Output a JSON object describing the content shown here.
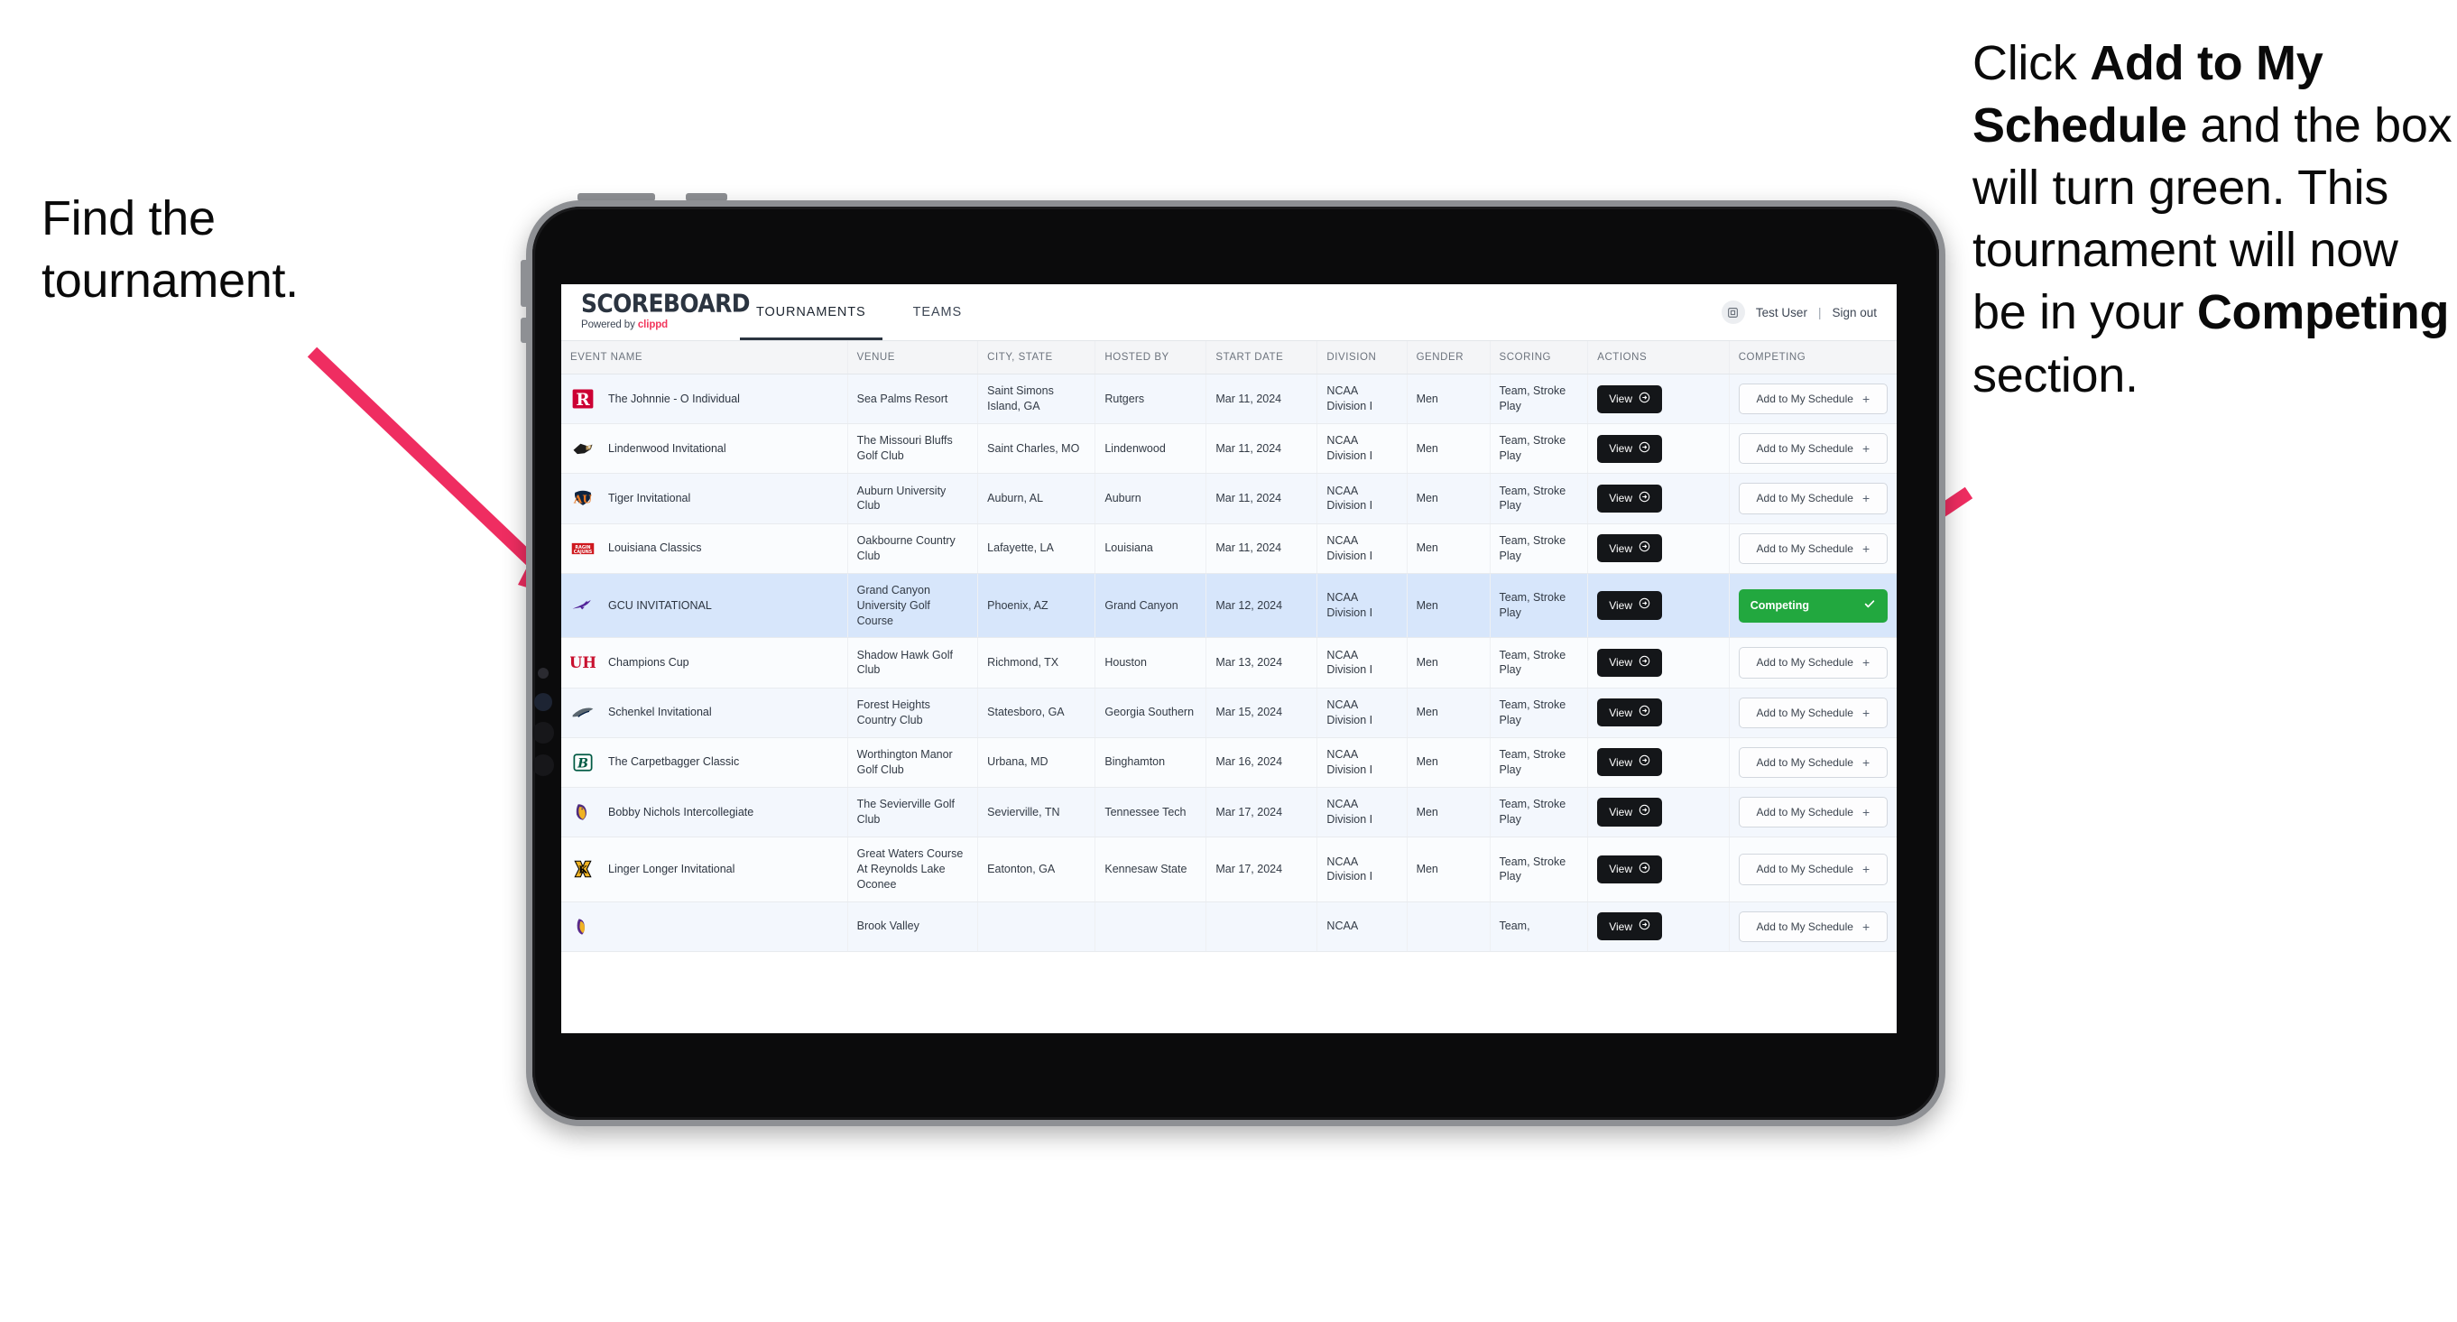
{
  "annotations": {
    "left": "Find the tournament.",
    "right_parts": [
      {
        "text": "Click ",
        "bold": false
      },
      {
        "text": "Add to My Schedule",
        "bold": true
      },
      {
        "text": " and the box will turn green. This tournament will now be in your ",
        "bold": false
      },
      {
        "text": "Competing",
        "bold": true
      },
      {
        "text": " section.",
        "bold": false
      }
    ],
    "arrow_color": "#ef2d61"
  },
  "app": {
    "brand_name": "SCOREBOARD",
    "brand_powered_prefix": "Powered by ",
    "brand_powered_name": "clippd",
    "tabs": [
      {
        "label": "TOURNAMENTS",
        "active": true
      },
      {
        "label": "TEAMS",
        "active": false
      }
    ],
    "user": {
      "avatar_icon": "user-badge-icon",
      "name": "Test User",
      "separator": "|",
      "sign_out": "Sign out"
    }
  },
  "table": {
    "columns": [
      "EVENT NAME",
      "VENUE",
      "CITY, STATE",
      "HOSTED BY",
      "START DATE",
      "DIVISION",
      "GENDER",
      "SCORING",
      "ACTIONS",
      "COMPETING"
    ],
    "view_label": "View",
    "add_label": "Add to My Schedule",
    "add_plus": "+",
    "competing_label": "Competing",
    "rows": [
      {
        "logo": "rutgers",
        "event": "The Johnnie - O Individual",
        "venue": "Sea Palms Resort",
        "city": "Saint Simons Island, GA",
        "host": "Rutgers",
        "date": "Mar 11, 2024",
        "division": "NCAA Division I",
        "gender": "Men",
        "scoring": "Team, Stroke Play",
        "competing": false
      },
      {
        "logo": "lindenwood",
        "event": "Lindenwood Invitational",
        "venue": "The Missouri Bluffs Golf Club",
        "city": "Saint Charles, MO",
        "host": "Lindenwood",
        "date": "Mar 11, 2024",
        "division": "NCAA Division I",
        "gender": "Men",
        "scoring": "Team, Stroke Play",
        "competing": false
      },
      {
        "logo": "auburn",
        "event": "Tiger Invitational",
        "venue": "Auburn University Club",
        "city": "Auburn, AL",
        "host": "Auburn",
        "date": "Mar 11, 2024",
        "division": "NCAA Division I",
        "gender": "Men",
        "scoring": "Team, Stroke Play",
        "competing": false
      },
      {
        "logo": "louisiana",
        "event": "Louisiana Classics",
        "venue": "Oakbourne Country Club",
        "city": "Lafayette, LA",
        "host": "Louisiana",
        "date": "Mar 11, 2024",
        "division": "NCAA Division I",
        "gender": "Men",
        "scoring": "Team, Stroke Play",
        "competing": false
      },
      {
        "logo": "gcu",
        "event": "GCU INVITATIONAL",
        "venue": "Grand Canyon University Golf Course",
        "city": "Phoenix, AZ",
        "host": "Grand Canyon",
        "date": "Mar 12, 2024",
        "division": "NCAA Division I",
        "gender": "Men",
        "scoring": "Team, Stroke Play",
        "competing": true
      },
      {
        "logo": "houston",
        "event": "Champions Cup",
        "venue": "Shadow Hawk Golf Club",
        "city": "Richmond, TX",
        "host": "Houston",
        "date": "Mar 13, 2024",
        "division": "NCAA Division I",
        "gender": "Men",
        "scoring": "Team, Stroke Play",
        "competing": false
      },
      {
        "logo": "georgiasouthern",
        "event": "Schenkel Invitational",
        "venue": "Forest Heights Country Club",
        "city": "Statesboro, GA",
        "host": "Georgia Southern",
        "date": "Mar 15, 2024",
        "division": "NCAA Division I",
        "gender": "Men",
        "scoring": "Team, Stroke Play",
        "competing": false
      },
      {
        "logo": "binghamton",
        "event": "The Carpetbagger Classic",
        "venue": "Worthington Manor Golf Club",
        "city": "Urbana, MD",
        "host": "Binghamton",
        "date": "Mar 16, 2024",
        "division": "NCAA Division I",
        "gender": "Men",
        "scoring": "Team, Stroke Play",
        "competing": false
      },
      {
        "logo": "tennesseetech",
        "event": "Bobby Nichols Intercollegiate",
        "venue": "The Sevierville Golf Club",
        "city": "Sevierville, TN",
        "host": "Tennessee Tech",
        "date": "Mar 17, 2024",
        "division": "NCAA Division I",
        "gender": "Men",
        "scoring": "Team, Stroke Play",
        "competing": false
      },
      {
        "logo": "kennesaw",
        "event": "Linger Longer Invitational",
        "venue": "Great Waters Course At Reynolds Lake Oconee",
        "city": "Eatonton, GA",
        "host": "Kennesaw State",
        "date": "Mar 17, 2024",
        "division": "NCAA Division I",
        "gender": "Men",
        "scoring": "Team, Stroke Play",
        "competing": false
      },
      {
        "logo": "eastcarolina",
        "event": "",
        "venue": "Brook Valley",
        "city": "",
        "host": "",
        "date": "",
        "division": "NCAA",
        "gender": "",
        "scoring": "Team,",
        "competing": false,
        "cut": true
      }
    ]
  },
  "colors": {
    "accent_green": "#22a83f",
    "accent_pink": "#ef2d61",
    "highlight_row": "#d7e6fb",
    "dark_button": "#141619"
  }
}
